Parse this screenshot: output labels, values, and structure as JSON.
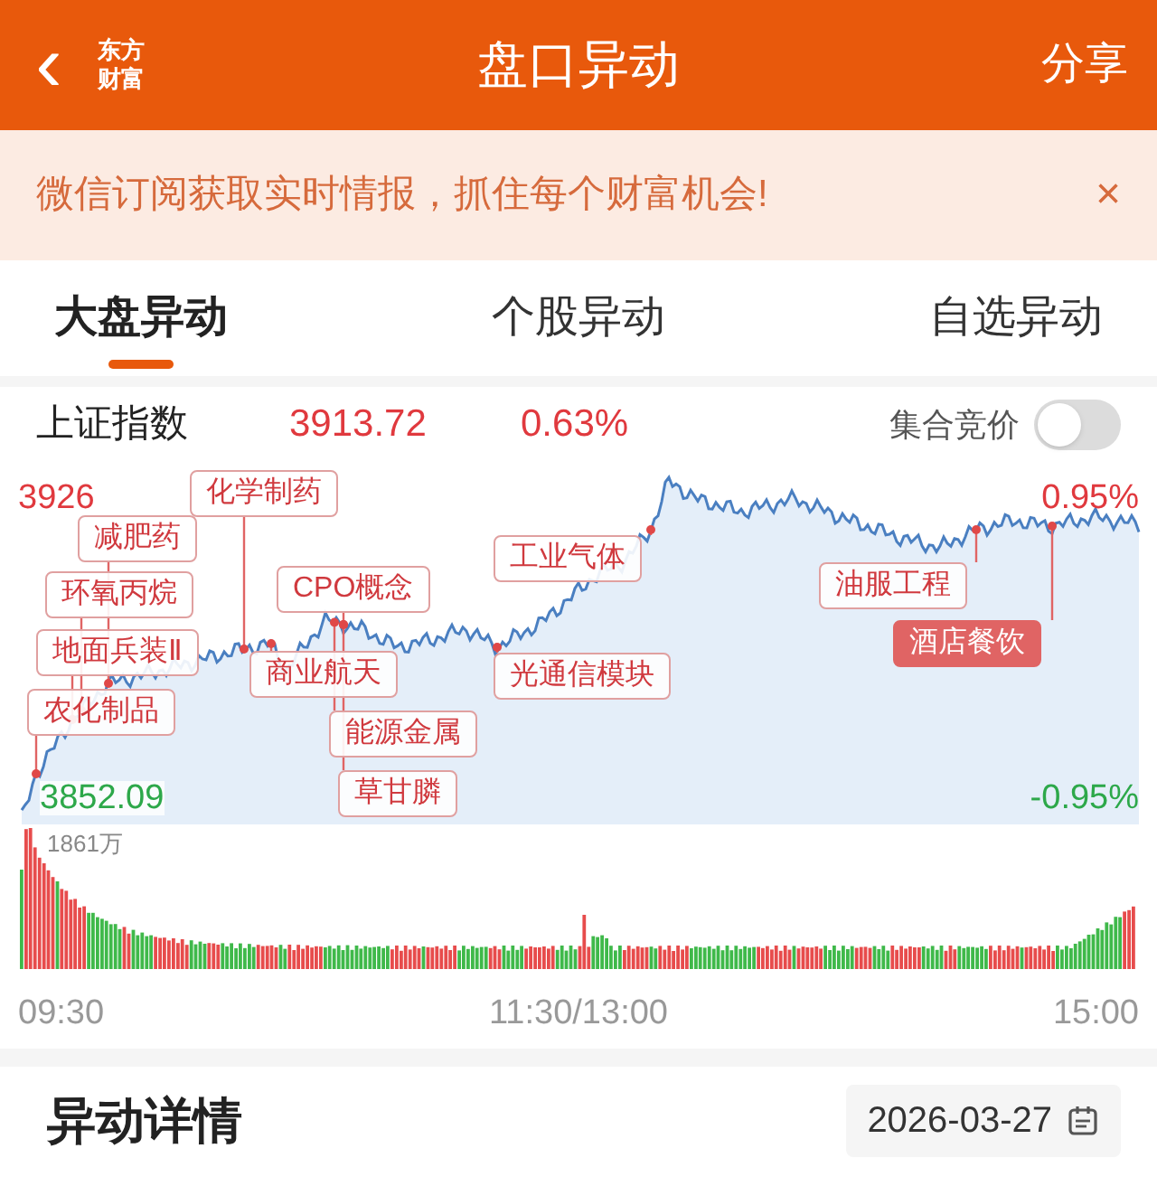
{
  "header": {
    "back": "‹",
    "logo": [
      "东方",
      "财富"
    ],
    "title": "盘口异动",
    "action": "分享"
  },
  "banner": {
    "text": "微信订阅获取实时情报，抓住每个财富机会!",
    "close": "×"
  },
  "tabs": [
    {
      "label": "大盘异动",
      "selected": true
    },
    {
      "label": "个股异动",
      "selected": false
    },
    {
      "label": "自选异动",
      "selected": false
    }
  ],
  "index": {
    "name": "上证指数",
    "price": "3913.72",
    "change": "0.63%",
    "auction_toggle": {
      "label": "集合竞价",
      "on": false
    }
  },
  "chart": {
    "high": "3926",
    "low": "3852.09",
    "high_pct": "0.95%",
    "low_pct": "-0.95%",
    "volume_max": "1861万",
    "tags": [
      {
        "text": "化学制药",
        "selected": false
      },
      {
        "text": "减肥药",
        "selected": false
      },
      {
        "text": "环氧丙烷",
        "selected": false
      },
      {
        "text": "地面兵装Ⅱ",
        "selected": false
      },
      {
        "text": "农化制品",
        "selected": false
      },
      {
        "text": "CPO概念",
        "selected": false
      },
      {
        "text": "商业航天",
        "selected": false
      },
      {
        "text": "能源金属",
        "selected": false
      },
      {
        "text": "草甘膦",
        "selected": false
      },
      {
        "text": "工业气体",
        "selected": false
      },
      {
        "text": "光通信模块",
        "selected": false
      },
      {
        "text": "油服工程",
        "selected": false
      },
      {
        "text": "酒店餐饮",
        "selected": true
      }
    ],
    "times": [
      "09:30",
      "11:30/13:00",
      "15:00"
    ]
  },
  "details": {
    "title": "异动详情",
    "date": "2026-03-27"
  }
}
